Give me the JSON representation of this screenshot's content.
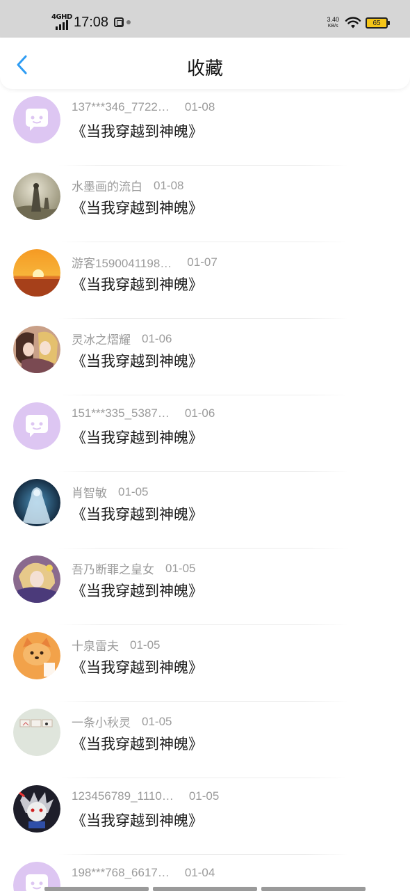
{
  "status_bar": {
    "network": "4GHD",
    "time": "17:08",
    "speed_value": "3.40",
    "speed_unit": "KB/s",
    "battery": "65"
  },
  "header": {
    "title": "收藏",
    "back_icon": "chevron-left-icon"
  },
  "colors": {
    "accent": "#2e9cf3",
    "default_avatar_bg": "#ddc6f2",
    "battery": "#f5c518"
  },
  "items": [
    {
      "name": "137***346_7722…",
      "date": "01-08",
      "book": "《当我穿越到神魄》",
      "avatar": "default-chat-icon"
    },
    {
      "name": "水墨画的流白",
      "date": "01-08",
      "book": "《当我穿越到神魄》",
      "avatar": "ink-painting"
    },
    {
      "name": "游客1590041198…",
      "date": "01-07",
      "book": "《当我穿越到神魄》",
      "avatar": "sunset"
    },
    {
      "name": "灵冰之熠耀",
      "date": "01-06",
      "book": "《当我穿越到神魄》",
      "avatar": "anime-girls"
    },
    {
      "name": "151***335_5387…",
      "date": "01-06",
      "book": "《当我穿越到神魄》",
      "avatar": "default-chat-icon"
    },
    {
      "name": "肖智敏",
      "date": "01-05",
      "book": "《当我穿越到神魄》",
      "avatar": "ghost-bride"
    },
    {
      "name": "吾乃断罪之皇女",
      "date": "01-05",
      "book": "《当我穿越到神魄》",
      "avatar": "anime-princess"
    },
    {
      "name": "十泉雷夫",
      "date": "01-05",
      "book": "《当我穿越到神魄》",
      "avatar": "cartoon-fox"
    },
    {
      "name": "一条小秋灵",
      "date": "01-05",
      "book": "《当我穿越到神魄》",
      "avatar": "love-letters"
    },
    {
      "name": "123456789_1110…",
      "date": "01-05",
      "book": "《当我穿越到神魄》",
      "avatar": "anime-warrior"
    },
    {
      "name": "198***768_6617…",
      "date": "01-04",
      "book": "",
      "avatar": "default-chat-icon"
    }
  ]
}
